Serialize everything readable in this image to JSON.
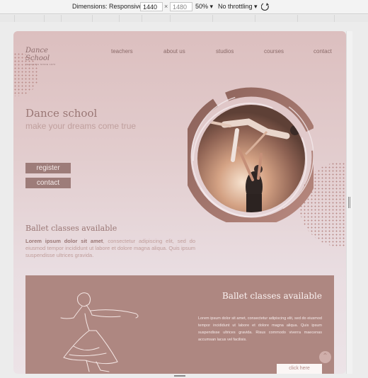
{
  "devtools": {
    "dimensions_label": "Dimensions: Responsive",
    "width": "1440",
    "height": "1480",
    "zoom": "50%",
    "throttling": "No throttling",
    "rotate_icon": "rotate-icon"
  },
  "site": {
    "logo_main": "Dance School",
    "logo_sub": "TEACHING SINCE 1970",
    "nav": [
      "teachers",
      "about us",
      "studios",
      "courses",
      "contact"
    ],
    "hero_title": "Dance school",
    "hero_subtitle": "make your dreams come true",
    "register_label": "register",
    "contact_label": "contact",
    "section_title": "Ballet classes available",
    "section_lead": "Lorem ipsum dolor sit amet",
    "section_text": ", consectetur adipiscing elit, sed do eiusmod tempor incididunt ut labore et dolore magna aliqua. Quis ipsum suspendisse ultrices gravida.",
    "band_title": "Ballet classes available",
    "band_text": "Lorem ipsum dolor sit amet, consectetur adipiscing elit, sed do eiusmod tempor incididunt ut labore et dolore magna aliqua. Quis ipsum suspendisse ultrices gravida. Risus commodo viverra maecenas accumsan lacus vel facilisis.",
    "band_button": "click here",
    "up_icon": "chevron-up-icon"
  },
  "colors": {
    "accent": "#9d7c79",
    "band": "#ae8781",
    "background": "#e6d3d6"
  }
}
